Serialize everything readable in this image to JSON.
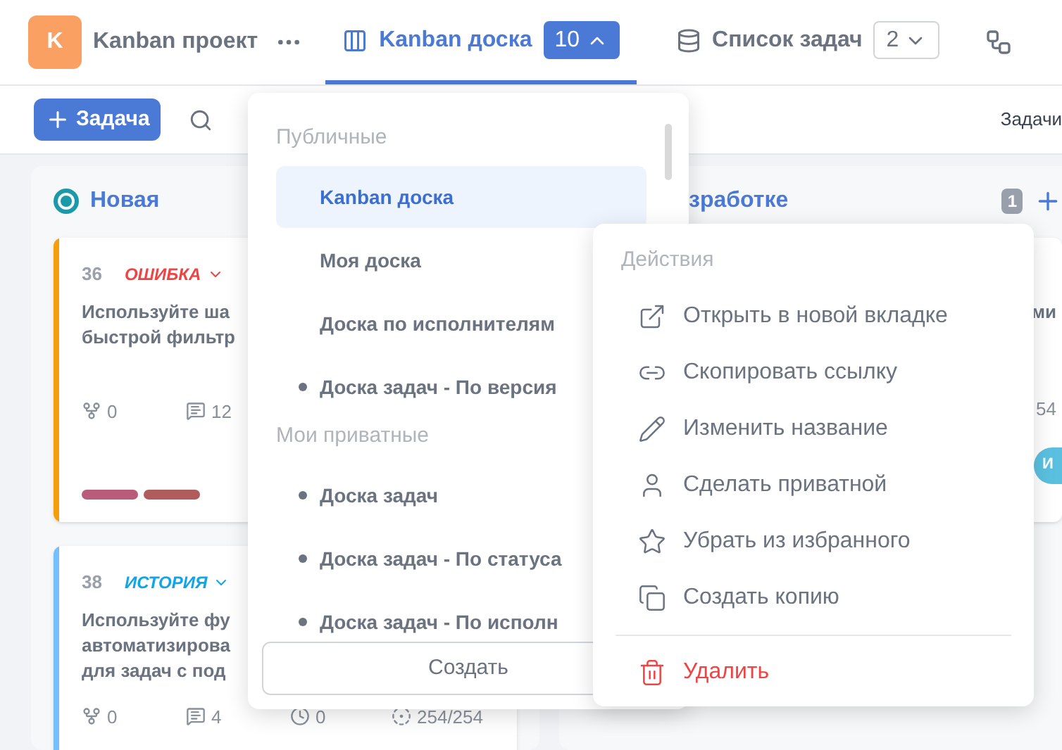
{
  "header": {
    "project_initial": "K",
    "project_name": "Kanban проект",
    "tabs": [
      {
        "label": "Kanban доска",
        "count": "10",
        "selected": true,
        "expanded": true
      },
      {
        "label": "Список задач",
        "count": "2",
        "selected": false,
        "expanded": false
      }
    ]
  },
  "toolbar": {
    "add_button": "Задача",
    "right_label": "Задачи"
  },
  "columns": [
    {
      "title": "Новая",
      "cards": [
        {
          "number": "36",
          "type": {
            "label": "ОШИБКА",
            "color": "#ef4444"
          },
          "color": "#f59e0b",
          "title": [
            "Используйте ша",
            "быстрой фильтр"
          ],
          "subtasks": "0",
          "comments": "12",
          "tags": [
            {
              "color": "#b85c7a"
            },
            {
              "color": "#b05c5c"
            }
          ]
        },
        {
          "number": "38",
          "type": {
            "label": "ИСТОРИЯ",
            "color": "#0ea5e9"
          },
          "color": "#74c0fc",
          "title": [
            "Используйте фу",
            "автоматизирова",
            "для задач с под"
          ],
          "subtasks": "0",
          "comments": "4",
          "time": "0",
          "progress": "254/254"
        }
      ]
    },
    {
      "title": "зработке",
      "count": "1",
      "cards": [
        {
          "title": [
            "ми"
          ],
          "progress": "54",
          "avatar": "И"
        }
      ]
    }
  ],
  "board_menu": {
    "sections": [
      {
        "title": "Публичные",
        "items": [
          {
            "label": "Kanban доска",
            "selected": true,
            "private": false
          },
          {
            "label": "Моя доска",
            "selected": false,
            "private": false
          },
          {
            "label": "Доска по исполнителям",
            "selected": false,
            "private": false
          },
          {
            "label": "Доска задач - По версия",
            "selected": false,
            "private": true
          }
        ]
      },
      {
        "title": "Мои приватные",
        "items": [
          {
            "label": "Доска задач",
            "selected": false,
            "private": true
          },
          {
            "label": "Доска задач - По статуса",
            "selected": false,
            "private": true
          },
          {
            "label": "Доска задач - По исполн",
            "selected": false,
            "private": true
          }
        ]
      }
    ],
    "create_button": "Создать"
  },
  "actions_menu": {
    "title": "Действия",
    "items": [
      {
        "kind": "open",
        "label": "Открыть в новой вкладке"
      },
      {
        "kind": "link",
        "label": "Скопировать ссылку"
      },
      {
        "kind": "rename",
        "label": "Изменить название"
      },
      {
        "kind": "private",
        "label": "Сделать приватной"
      },
      {
        "kind": "unfavorite",
        "label": "Убрать из избранного"
      },
      {
        "kind": "copy",
        "label": "Создать копию"
      },
      {
        "kind": "delete",
        "label": "Удалить"
      }
    ]
  }
}
